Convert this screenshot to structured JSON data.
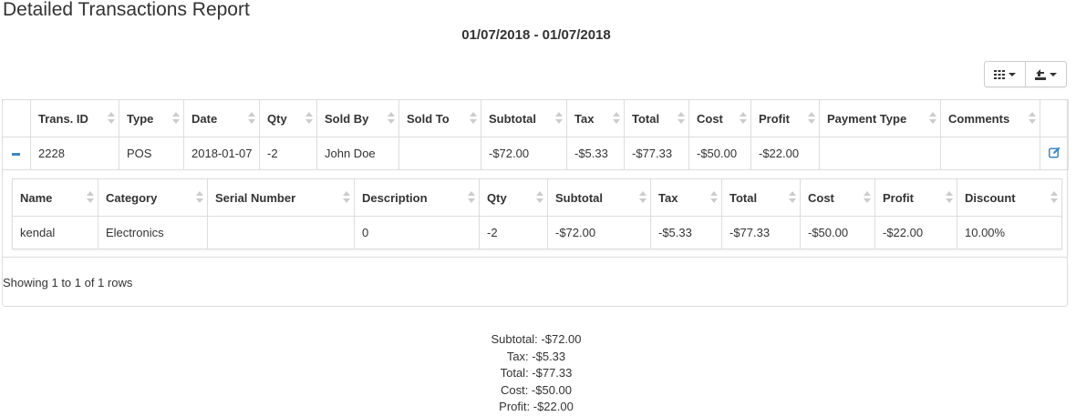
{
  "page": {
    "title": "Detailed Transactions Report",
    "date_range": "01/07/2018 - 01/07/2018"
  },
  "toolbar": {
    "columns_icon": "grid-icon",
    "export_icon": "export-icon"
  },
  "main_table": {
    "headers": [
      "Trans. ID",
      "Type",
      "Date",
      "Qty",
      "Sold By",
      "Sold To",
      "Subtotal",
      "Tax",
      "Total",
      "Cost",
      "Profit",
      "Payment Type",
      "Comments"
    ],
    "rows": [
      {
        "trans_id": "2228",
        "type": "POS",
        "date": "2018-01-07",
        "qty": "-2",
        "sold_by": "John Doe",
        "sold_to": "",
        "subtotal": "-$72.00",
        "tax": "-$5.33",
        "total": "-$77.33",
        "cost": "-$50.00",
        "profit": "-$22.00",
        "payment_type": "",
        "comments": ""
      }
    ]
  },
  "detail_table": {
    "headers": [
      "Name",
      "Category",
      "Serial Number",
      "Description",
      "Qty",
      "Subtotal",
      "Tax",
      "Total",
      "Cost",
      "Profit",
      "Discount"
    ],
    "rows": [
      {
        "name": "kendal",
        "category": "Electronics",
        "serial_number": "",
        "description": "0",
        "qty": "-2",
        "subtotal": "-$72.00",
        "tax": "-$5.33",
        "total": "-$77.33",
        "cost": "-$50.00",
        "profit": "-$22.00",
        "discount": "10.00%"
      }
    ]
  },
  "pagination": {
    "info": "Showing 1 to 1 of 1 rows"
  },
  "summary": {
    "subtotal": "Subtotal: -$72.00",
    "tax": "Tax: -$5.33",
    "total": "Total: -$77.33",
    "cost": "Cost: -$50.00",
    "profit": "Profit: -$22.00"
  },
  "colors": {
    "accent": "#3a87c8",
    "border": "#dddddd",
    "text": "#333333"
  }
}
